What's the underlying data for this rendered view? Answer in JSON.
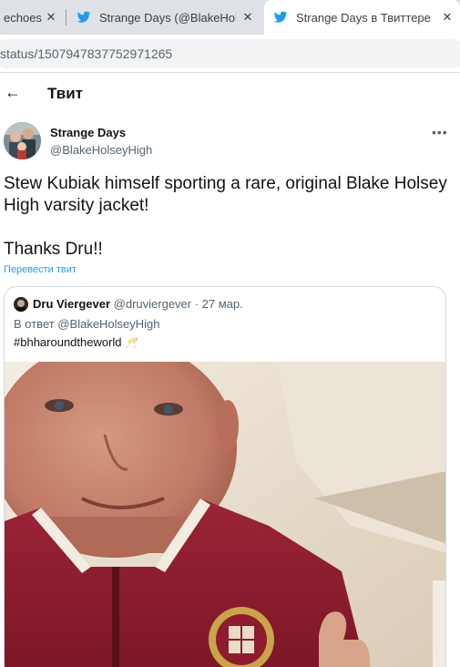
{
  "browser": {
    "tabs": [
      {
        "title": "echoes",
        "close": "✕"
      },
      {
        "title": "Strange Days (@BlakeHolseyHigh)",
        "close": "✕"
      },
      {
        "title": "Strange Days в Твиттере",
        "close": "✕"
      }
    ],
    "address": "status/1507947837752971265"
  },
  "header": {
    "back": "←",
    "title": "Твит"
  },
  "tweet": {
    "author_name": "Strange Days",
    "author_handle": "@BlakeHolseyHigh",
    "more": "•••",
    "text_line1": "Stew Kubiak himself sporting a rare, original Blake Holsey High varsity jacket!",
    "text_line2": "Thanks Dru!!",
    "translate": "Перевести твит"
  },
  "quoted": {
    "name": "Dru Viergever",
    "handle_date": "@druviergever · 27 мар.",
    "reply_prefix": "В ответ",
    "reply_mention": "@BlakeHolseyHigh",
    "hashtag": "#bhharoundtheworld",
    "emoji": "🥂"
  },
  "colors": {
    "link": "#1d9bf0",
    "jacket": "#8e1c2e",
    "tab_strip": "#dee1e6"
  },
  "icons": [
    "twitter-bird-icon",
    "close-icon",
    "back-arrow-icon",
    "more-icon",
    "cheers-emoji-icon"
  ]
}
